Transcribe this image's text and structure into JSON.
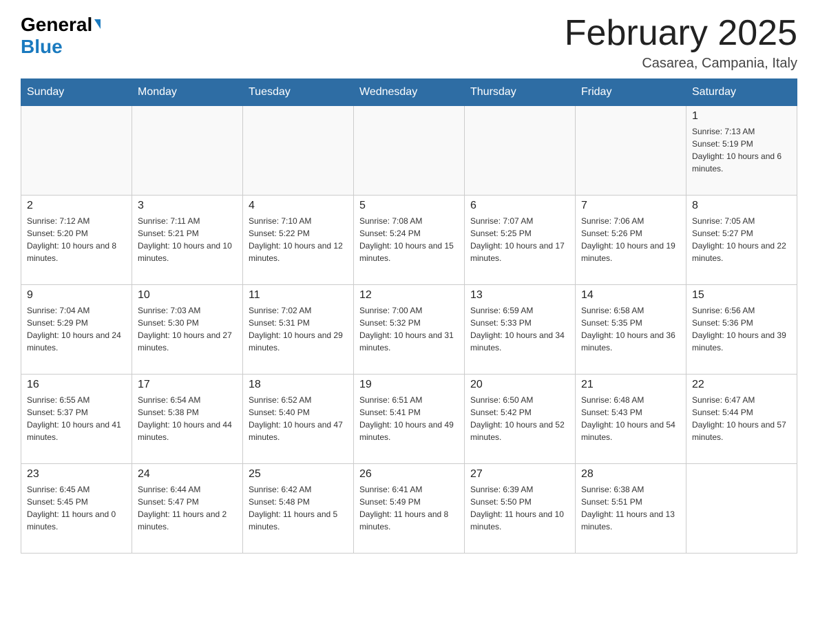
{
  "header": {
    "logo_general": "General",
    "logo_blue": "Blue",
    "month_title": "February 2025",
    "location": "Casarea, Campania, Italy"
  },
  "days_of_week": [
    "Sunday",
    "Monday",
    "Tuesday",
    "Wednesday",
    "Thursday",
    "Friday",
    "Saturday"
  ],
  "weeks": [
    [
      {
        "day": "",
        "info": ""
      },
      {
        "day": "",
        "info": ""
      },
      {
        "day": "",
        "info": ""
      },
      {
        "day": "",
        "info": ""
      },
      {
        "day": "",
        "info": ""
      },
      {
        "day": "",
        "info": ""
      },
      {
        "day": "1",
        "info": "Sunrise: 7:13 AM\nSunset: 5:19 PM\nDaylight: 10 hours and 6 minutes."
      }
    ],
    [
      {
        "day": "2",
        "info": "Sunrise: 7:12 AM\nSunset: 5:20 PM\nDaylight: 10 hours and 8 minutes."
      },
      {
        "day": "3",
        "info": "Sunrise: 7:11 AM\nSunset: 5:21 PM\nDaylight: 10 hours and 10 minutes."
      },
      {
        "day": "4",
        "info": "Sunrise: 7:10 AM\nSunset: 5:22 PM\nDaylight: 10 hours and 12 minutes."
      },
      {
        "day": "5",
        "info": "Sunrise: 7:08 AM\nSunset: 5:24 PM\nDaylight: 10 hours and 15 minutes."
      },
      {
        "day": "6",
        "info": "Sunrise: 7:07 AM\nSunset: 5:25 PM\nDaylight: 10 hours and 17 minutes."
      },
      {
        "day": "7",
        "info": "Sunrise: 7:06 AM\nSunset: 5:26 PM\nDaylight: 10 hours and 19 minutes."
      },
      {
        "day": "8",
        "info": "Sunrise: 7:05 AM\nSunset: 5:27 PM\nDaylight: 10 hours and 22 minutes."
      }
    ],
    [
      {
        "day": "9",
        "info": "Sunrise: 7:04 AM\nSunset: 5:29 PM\nDaylight: 10 hours and 24 minutes."
      },
      {
        "day": "10",
        "info": "Sunrise: 7:03 AM\nSunset: 5:30 PM\nDaylight: 10 hours and 27 minutes."
      },
      {
        "day": "11",
        "info": "Sunrise: 7:02 AM\nSunset: 5:31 PM\nDaylight: 10 hours and 29 minutes."
      },
      {
        "day": "12",
        "info": "Sunrise: 7:00 AM\nSunset: 5:32 PM\nDaylight: 10 hours and 31 minutes."
      },
      {
        "day": "13",
        "info": "Sunrise: 6:59 AM\nSunset: 5:33 PM\nDaylight: 10 hours and 34 minutes."
      },
      {
        "day": "14",
        "info": "Sunrise: 6:58 AM\nSunset: 5:35 PM\nDaylight: 10 hours and 36 minutes."
      },
      {
        "day": "15",
        "info": "Sunrise: 6:56 AM\nSunset: 5:36 PM\nDaylight: 10 hours and 39 minutes."
      }
    ],
    [
      {
        "day": "16",
        "info": "Sunrise: 6:55 AM\nSunset: 5:37 PM\nDaylight: 10 hours and 41 minutes."
      },
      {
        "day": "17",
        "info": "Sunrise: 6:54 AM\nSunset: 5:38 PM\nDaylight: 10 hours and 44 minutes."
      },
      {
        "day": "18",
        "info": "Sunrise: 6:52 AM\nSunset: 5:40 PM\nDaylight: 10 hours and 47 minutes."
      },
      {
        "day": "19",
        "info": "Sunrise: 6:51 AM\nSunset: 5:41 PM\nDaylight: 10 hours and 49 minutes."
      },
      {
        "day": "20",
        "info": "Sunrise: 6:50 AM\nSunset: 5:42 PM\nDaylight: 10 hours and 52 minutes."
      },
      {
        "day": "21",
        "info": "Sunrise: 6:48 AM\nSunset: 5:43 PM\nDaylight: 10 hours and 54 minutes."
      },
      {
        "day": "22",
        "info": "Sunrise: 6:47 AM\nSunset: 5:44 PM\nDaylight: 10 hours and 57 minutes."
      }
    ],
    [
      {
        "day": "23",
        "info": "Sunrise: 6:45 AM\nSunset: 5:45 PM\nDaylight: 11 hours and 0 minutes."
      },
      {
        "day": "24",
        "info": "Sunrise: 6:44 AM\nSunset: 5:47 PM\nDaylight: 11 hours and 2 minutes."
      },
      {
        "day": "25",
        "info": "Sunrise: 6:42 AM\nSunset: 5:48 PM\nDaylight: 11 hours and 5 minutes."
      },
      {
        "day": "26",
        "info": "Sunrise: 6:41 AM\nSunset: 5:49 PM\nDaylight: 11 hours and 8 minutes."
      },
      {
        "day": "27",
        "info": "Sunrise: 6:39 AM\nSunset: 5:50 PM\nDaylight: 11 hours and 10 minutes."
      },
      {
        "day": "28",
        "info": "Sunrise: 6:38 AM\nSunset: 5:51 PM\nDaylight: 11 hours and 13 minutes."
      },
      {
        "day": "",
        "info": ""
      }
    ]
  ]
}
